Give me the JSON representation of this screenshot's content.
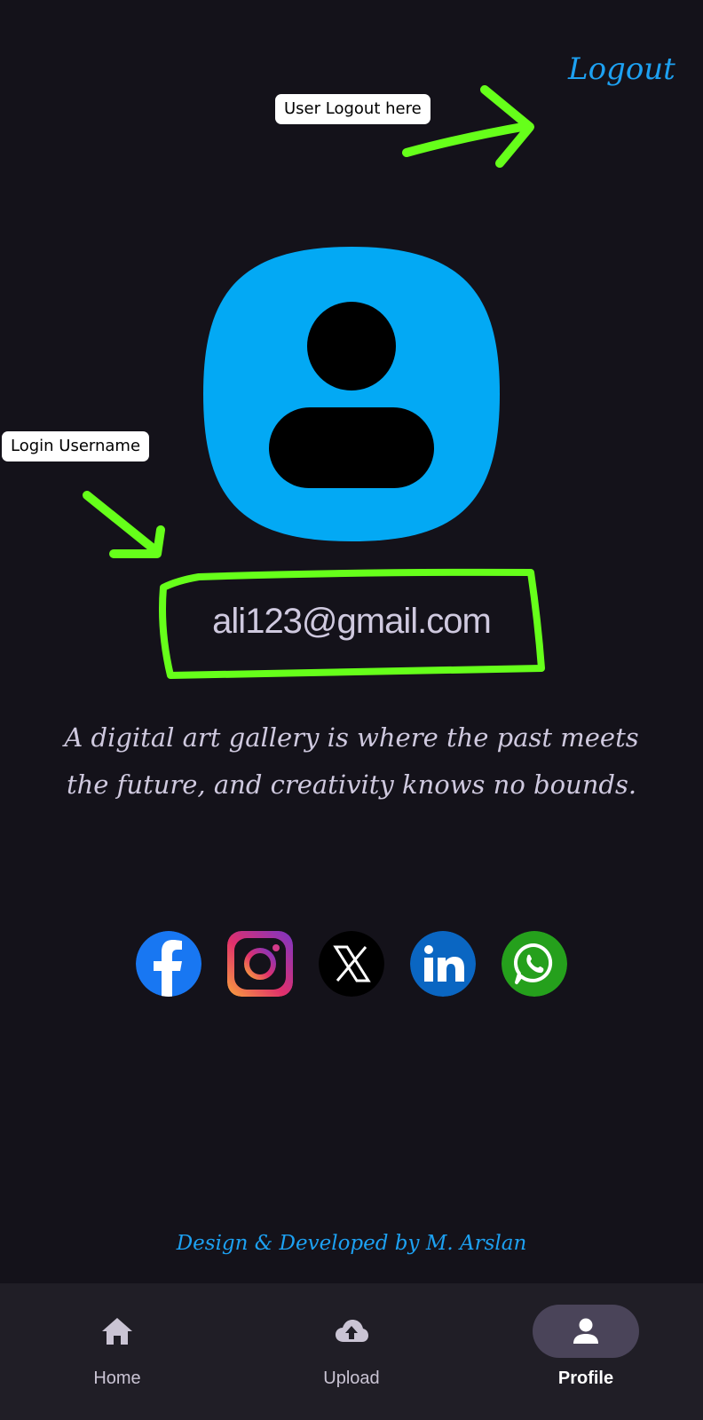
{
  "header": {
    "logout_label": "Logout"
  },
  "annotations": {
    "logout_note": "User Logout here",
    "username_note": "Login Username"
  },
  "profile": {
    "avatar_icon": "account-avatar-icon",
    "email": "ali123@gmail.com",
    "quote_line1": "A digital art gallery is where the past meets",
    "quote_line2": "the future, and creativity knows no bounds."
  },
  "socials": [
    {
      "name": "facebook",
      "icon": "facebook-icon",
      "color": "#1877f2"
    },
    {
      "name": "instagram",
      "icon": "instagram-icon",
      "color": "#c13584"
    },
    {
      "name": "x",
      "icon": "x-icon",
      "color": "#000000"
    },
    {
      "name": "linkedin",
      "icon": "linkedin-icon",
      "color": "#0a66c2"
    },
    {
      "name": "whatsapp",
      "icon": "whatsapp-icon",
      "color": "#25a01c"
    }
  ],
  "footer": {
    "credit": "Design & Developed by M. Arslan"
  },
  "nav": {
    "items": [
      {
        "label": "Home",
        "icon": "home-icon",
        "active": false
      },
      {
        "label": "Upload",
        "icon": "cloud-upload-icon",
        "active": false
      },
      {
        "label": "Profile",
        "icon": "person-icon",
        "active": true
      }
    ]
  },
  "colors": {
    "background": "#14121a",
    "accent": "#1da1f2",
    "avatar": "#03a9f4",
    "highlight": "#66ff1a",
    "navbar": "#201e26",
    "nav_active_pill": "#4a4459"
  }
}
